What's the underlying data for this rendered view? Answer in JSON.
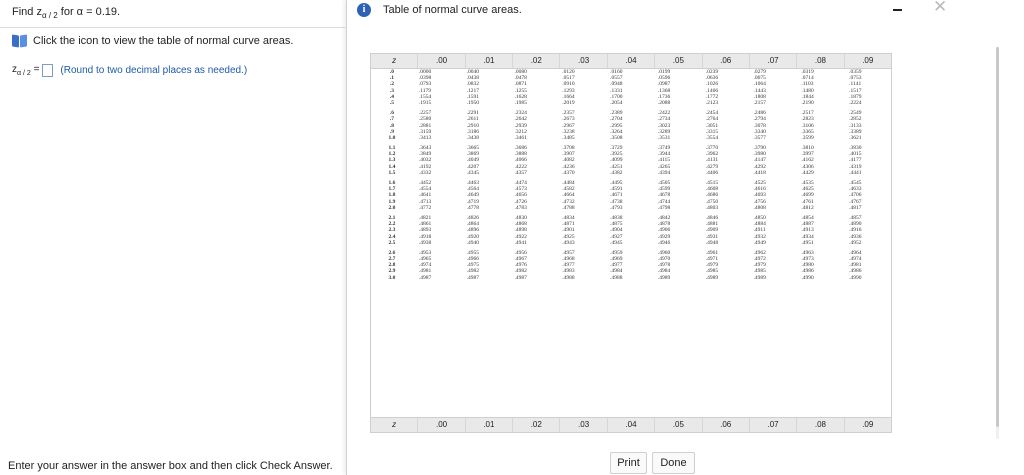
{
  "question": {
    "find_prefix": "Find z",
    "find_sub": "α / 2",
    "find_suffix": "for α = 0.19.",
    "help_text": "Click the icon to view the table of normal curve areas.",
    "answer_label_z": "z",
    "answer_label_sub": "α / 2",
    "answer_label_eq": "=",
    "answer_value": "",
    "round_hint": "(Round to two decimal places as needed.)",
    "instructions": "Enter your answer in the answer box and then click Check Answer."
  },
  "dialog": {
    "info_icon": "i",
    "title": "Table of normal curve areas.",
    "close_glyph": "✕",
    "print_label": "Print",
    "done_label": "Done"
  },
  "table": {
    "headers": [
      "z",
      ".00",
      ".01",
      ".02",
      ".03",
      ".04",
      ".05",
      ".06",
      ".07",
      ".08",
      ".09"
    ],
    "footers": [
      "z",
      ".00",
      ".01",
      ".02",
      ".03",
      ".04",
      ".05",
      ".06",
      ".07",
      ".08",
      ".09"
    ],
    "groups": [
      [
        [
          ".0",
          ".0000",
          ".0040",
          ".0080",
          ".0120",
          ".0160",
          ".0199",
          ".0239",
          ".0279",
          ".0319",
          ".0359"
        ],
        [
          ".1",
          ".0398",
          ".0438",
          ".0478",
          ".0517",
          ".0557",
          ".0596",
          ".0636",
          ".0675",
          ".0714",
          ".0753"
        ],
        [
          ".2",
          ".0793",
          ".0832",
          ".0871",
          ".0910",
          ".0948",
          ".0987",
          ".1026",
          ".1064",
          ".1103",
          ".1141"
        ],
        [
          ".3",
          ".1179",
          ".1217",
          ".1255",
          ".1293",
          ".1331",
          ".1368",
          ".1406",
          ".1443",
          ".1480",
          ".1517"
        ],
        [
          ".4",
          ".1554",
          ".1591",
          ".1628",
          ".1664",
          ".1700",
          ".1736",
          ".1772",
          ".1808",
          ".1844",
          ".1879"
        ],
        [
          ".5",
          ".1915",
          ".1950",
          ".1985",
          ".2019",
          ".2054",
          ".2088",
          ".2123",
          ".2157",
          ".2190",
          ".2224"
        ]
      ],
      [
        [
          ".6",
          ".2257",
          ".2291",
          ".2324",
          ".2357",
          ".2389",
          ".2422",
          ".2454",
          ".2486",
          ".2517",
          ".2549"
        ],
        [
          ".7",
          ".2580",
          ".2611",
          ".2642",
          ".2673",
          ".2704",
          ".2734",
          ".2764",
          ".2794",
          ".2823",
          ".2852"
        ],
        [
          ".8",
          ".2881",
          ".2910",
          ".2939",
          ".2967",
          ".2995",
          ".3023",
          ".3051",
          ".3078",
          ".3106",
          ".3133"
        ],
        [
          ".9",
          ".3159",
          ".3186",
          ".3212",
          ".3238",
          ".3264",
          ".3289",
          ".3315",
          ".3340",
          ".3365",
          ".3389"
        ],
        [
          "1.0",
          ".3413",
          ".3438",
          ".3461",
          ".3485",
          ".3508",
          ".3531",
          ".3554",
          ".3577",
          ".3599",
          ".3621"
        ]
      ],
      [
        [
          "1.1",
          ".3643",
          ".3665",
          ".3686",
          ".3708",
          ".3729",
          ".3749",
          ".3770",
          ".3790",
          ".3810",
          ".3830"
        ],
        [
          "1.2",
          ".3849",
          ".3869",
          ".3888",
          ".3907",
          ".3925",
          ".3944",
          ".3962",
          ".3980",
          ".3997",
          ".4015"
        ],
        [
          "1.3",
          ".4032",
          ".4049",
          ".4066",
          ".4082",
          ".4099",
          ".4115",
          ".4131",
          ".4147",
          ".4162",
          ".4177"
        ],
        [
          "1.4",
          ".4192",
          ".4207",
          ".4222",
          ".4236",
          ".4251",
          ".4265",
          ".4279",
          ".4292",
          ".4306",
          ".4319"
        ],
        [
          "1.5",
          ".4332",
          ".4345",
          ".4357",
          ".4370",
          ".4382",
          ".4394",
          ".4406",
          ".4418",
          ".4429",
          ".4441"
        ]
      ],
      [
        [
          "1.6",
          ".4452",
          ".4463",
          ".4474",
          ".4484",
          ".4495",
          ".4505",
          ".4515",
          ".4525",
          ".4535",
          ".4545"
        ],
        [
          "1.7",
          ".4554",
          ".4564",
          ".4573",
          ".4582",
          ".4591",
          ".4599",
          ".4608",
          ".4616",
          ".4625",
          ".4633"
        ],
        [
          "1.8",
          ".4641",
          ".4649",
          ".4656",
          ".4664",
          ".4671",
          ".4678",
          ".4686",
          ".4693",
          ".4699",
          ".4706"
        ],
        [
          "1.9",
          ".4713",
          ".4719",
          ".4726",
          ".4732",
          ".4738",
          ".4744",
          ".4750",
          ".4756",
          ".4761",
          ".4767"
        ],
        [
          "2.0",
          ".4772",
          ".4778",
          ".4783",
          ".4788",
          ".4793",
          ".4798",
          ".4803",
          ".4808",
          ".4812",
          ".4817"
        ]
      ],
      [
        [
          "2.1",
          ".4821",
          ".4826",
          ".4830",
          ".4834",
          ".4838",
          ".4842",
          ".4846",
          ".4850",
          ".4854",
          ".4857"
        ],
        [
          "2.2",
          ".4861",
          ".4864",
          ".4868",
          ".4871",
          ".4875",
          ".4878",
          ".4881",
          ".4884",
          ".4887",
          ".4890"
        ],
        [
          "2.3",
          ".4893",
          ".4896",
          ".4898",
          ".4901",
          ".4904",
          ".4906",
          ".4909",
          ".4911",
          ".4913",
          ".4916"
        ],
        [
          "2.4",
          ".4918",
          ".4920",
          ".4922",
          ".4925",
          ".4927",
          ".4929",
          ".4931",
          ".4932",
          ".4934",
          ".4936"
        ],
        [
          "2.5",
          ".4938",
          ".4940",
          ".4941",
          ".4943",
          ".4945",
          ".4946",
          ".4948",
          ".4949",
          ".4951",
          ".4952"
        ]
      ],
      [
        [
          "2.6",
          ".4953",
          ".4955",
          ".4956",
          ".4957",
          ".4959",
          ".4960",
          ".4961",
          ".4962",
          ".4963",
          ".4964"
        ],
        [
          "2.7",
          ".4965",
          ".4966",
          ".4967",
          ".4968",
          ".4969",
          ".4970",
          ".4971",
          ".4972",
          ".4973",
          ".4974"
        ],
        [
          "2.8",
          ".4974",
          ".4975",
          ".4976",
          ".4977",
          ".4977",
          ".4978",
          ".4979",
          ".4979",
          ".4980",
          ".4981"
        ],
        [
          "2.9",
          ".4981",
          ".4982",
          ".4982",
          ".4983",
          ".4984",
          ".4984",
          ".4985",
          ".4985",
          ".4986",
          ".4986"
        ],
        [
          "3.0",
          ".4987",
          ".4987",
          ".4987",
          ".4988",
          ".4988",
          ".4989",
          ".4989",
          ".4989",
          ".4990",
          ".4990"
        ]
      ]
    ]
  }
}
